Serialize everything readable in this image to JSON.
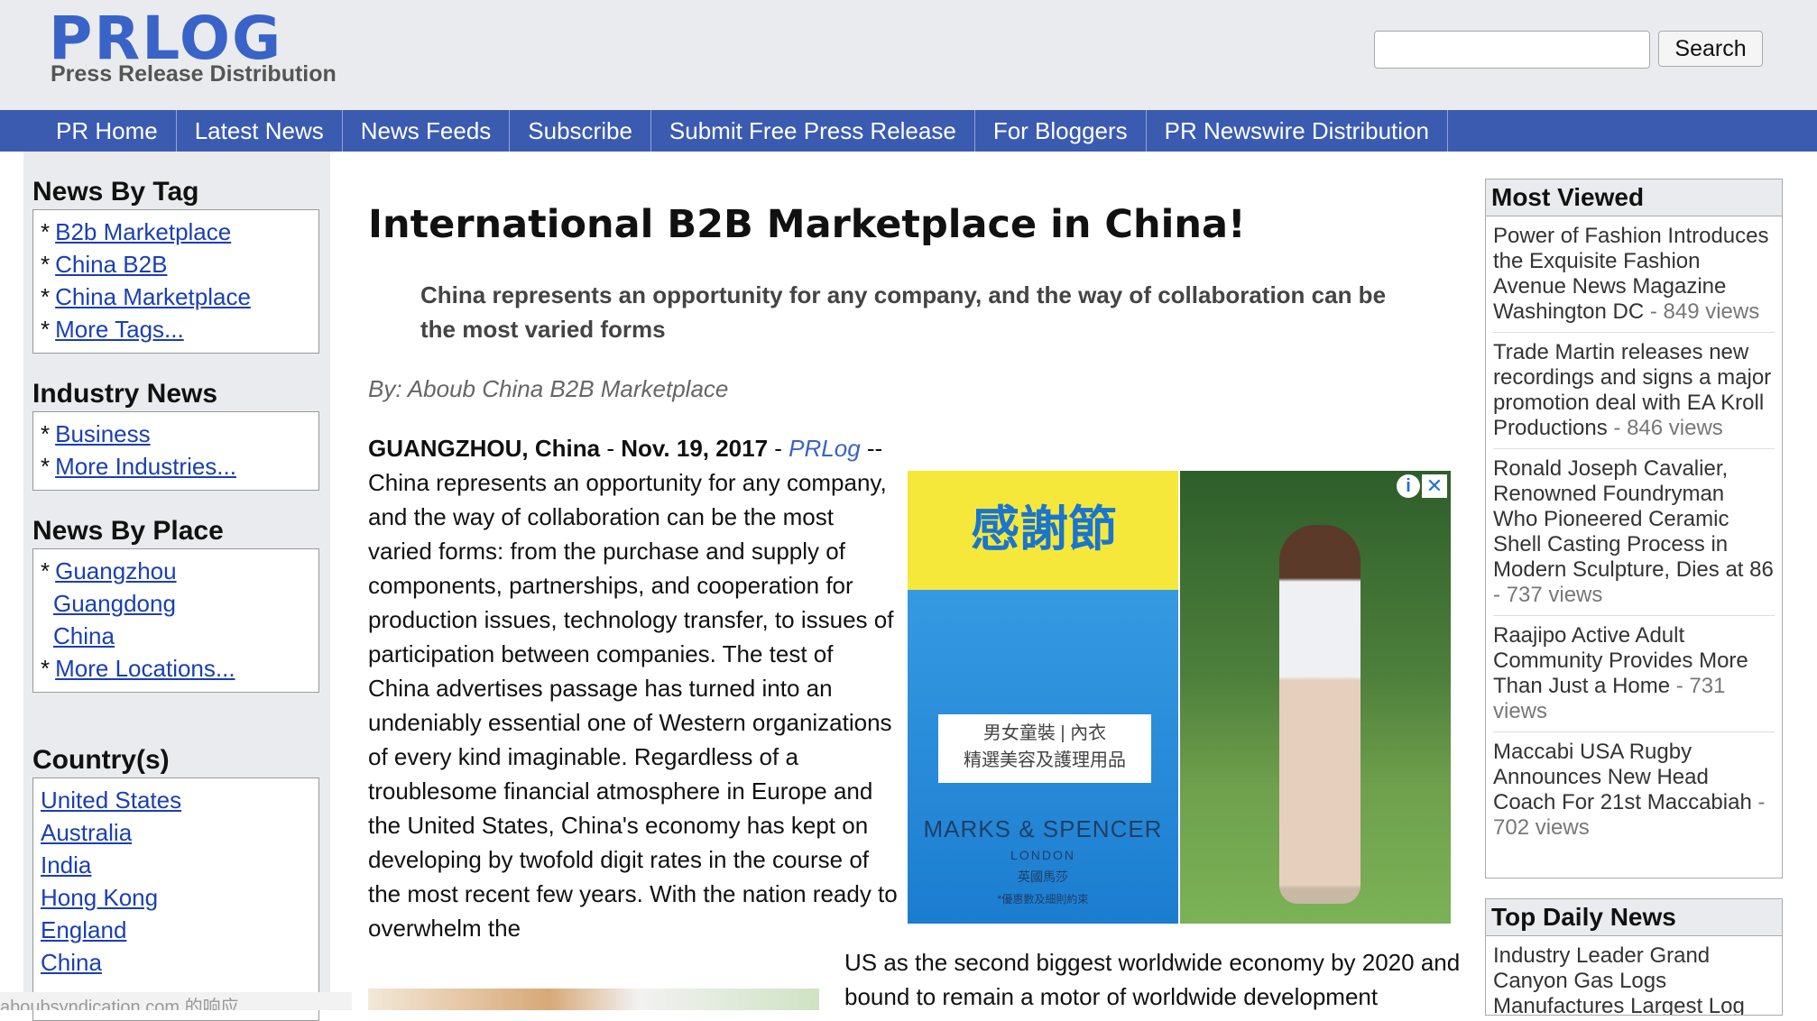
{
  "header": {
    "logo": "PRLOG",
    "tagline": "Press Release Distribution",
    "search_button": "Search"
  },
  "nav": [
    "PR Home",
    "Latest News",
    "News Feeds",
    "Subscribe",
    "Submit Free Press Release",
    "For Bloggers",
    "PR Newswire Distribution"
  ],
  "sidebar": {
    "tag_heading": "News By Tag",
    "tags": [
      "B2b Marketplace",
      "China B2B",
      "China Marketplace",
      "More Tags..."
    ],
    "industry_heading": "Industry News",
    "industries": [
      "Business",
      "More Industries..."
    ],
    "place_heading": "News By Place",
    "places": [
      "Guangzhou",
      "Guangdong",
      "China",
      "More Locations..."
    ],
    "country_heading": "Country(s)",
    "countries": [
      "United States",
      "Australia",
      "India",
      "Hong Kong",
      "England",
      "China"
    ],
    "country_more": "- - -"
  },
  "article": {
    "headline": "International B2B Marketplace in China!",
    "summary": "China represents an opportunity for any company, and the way of collaboration can be the most varied forms",
    "byline": "By: Aboub China B2B Marketplace",
    "dateline_place": "GUANGZHOU, China",
    "dateline_sep1": " - ",
    "dateline_date": "Nov. 19, 2017",
    "dateline_sep2": " - ",
    "dateline_source": "PRLog",
    "dateline_dash": " --",
    "body": "China represents an opportunity for any company, and the way of collaboration can be the most varied forms: from the purchase and supply of components, partnerships, and cooperation for production issues, technology transfer, to issues of participation between companies. The test of China advertises passage has turned into an undeniably essential one of Western organizations of every kind imaginable. Regardless of a troublesome financial atmosphere in Europe and the United States, China's economy has kept on developing by twofold digit rates in the course of the most recent few years. With the nation ready to overwhelm the",
    "body_continued": "US as the second biggest worldwide economy by 2020 and bound to remain a motor of worldwide development"
  },
  "ad": {
    "title": "感謝節",
    "card_line1": "男女童裝 | 內衣",
    "card_line2": "精選美容及護理用品",
    "brand": "MARKS & SPENCER",
    "brand_sub1": "LONDON",
    "brand_sub2": "英國馬莎",
    "brand_sub3": "*優惠數及細則約束",
    "info_icon": "i",
    "close_icon": "✕"
  },
  "most_viewed": {
    "heading": "Most Viewed",
    "items": [
      {
        "title": "Power of Fashion Introduces the Exquisite Fashion Avenue News Magazine Washington DC",
        "views": " - 849 views"
      },
      {
        "title": "Trade Martin releases new recordings and signs a major promotion deal with EA Kroll Productions",
        "views": " - 846 views"
      },
      {
        "title": "Ronald Joseph Cavalier, Renowned Foundryman Who Pioneered Ceramic Shell Casting Process in Modern Sculpture, Dies at 86",
        "views": " - 737 views"
      },
      {
        "title": "Raajipo Active Adult Community Provides More Than Just a Home",
        "views": " - 731 views"
      },
      {
        "title": "Maccabi USA Rugby Announces New Head Coach For 21st Maccabiah",
        "views": " - 702 views"
      }
    ]
  },
  "top_daily": {
    "heading": "Top Daily News",
    "first_item": "Industry Leader Grand Canyon Gas Logs Manufactures Largest Log"
  },
  "status_bar": "aboubsyndication.com 的响应"
}
